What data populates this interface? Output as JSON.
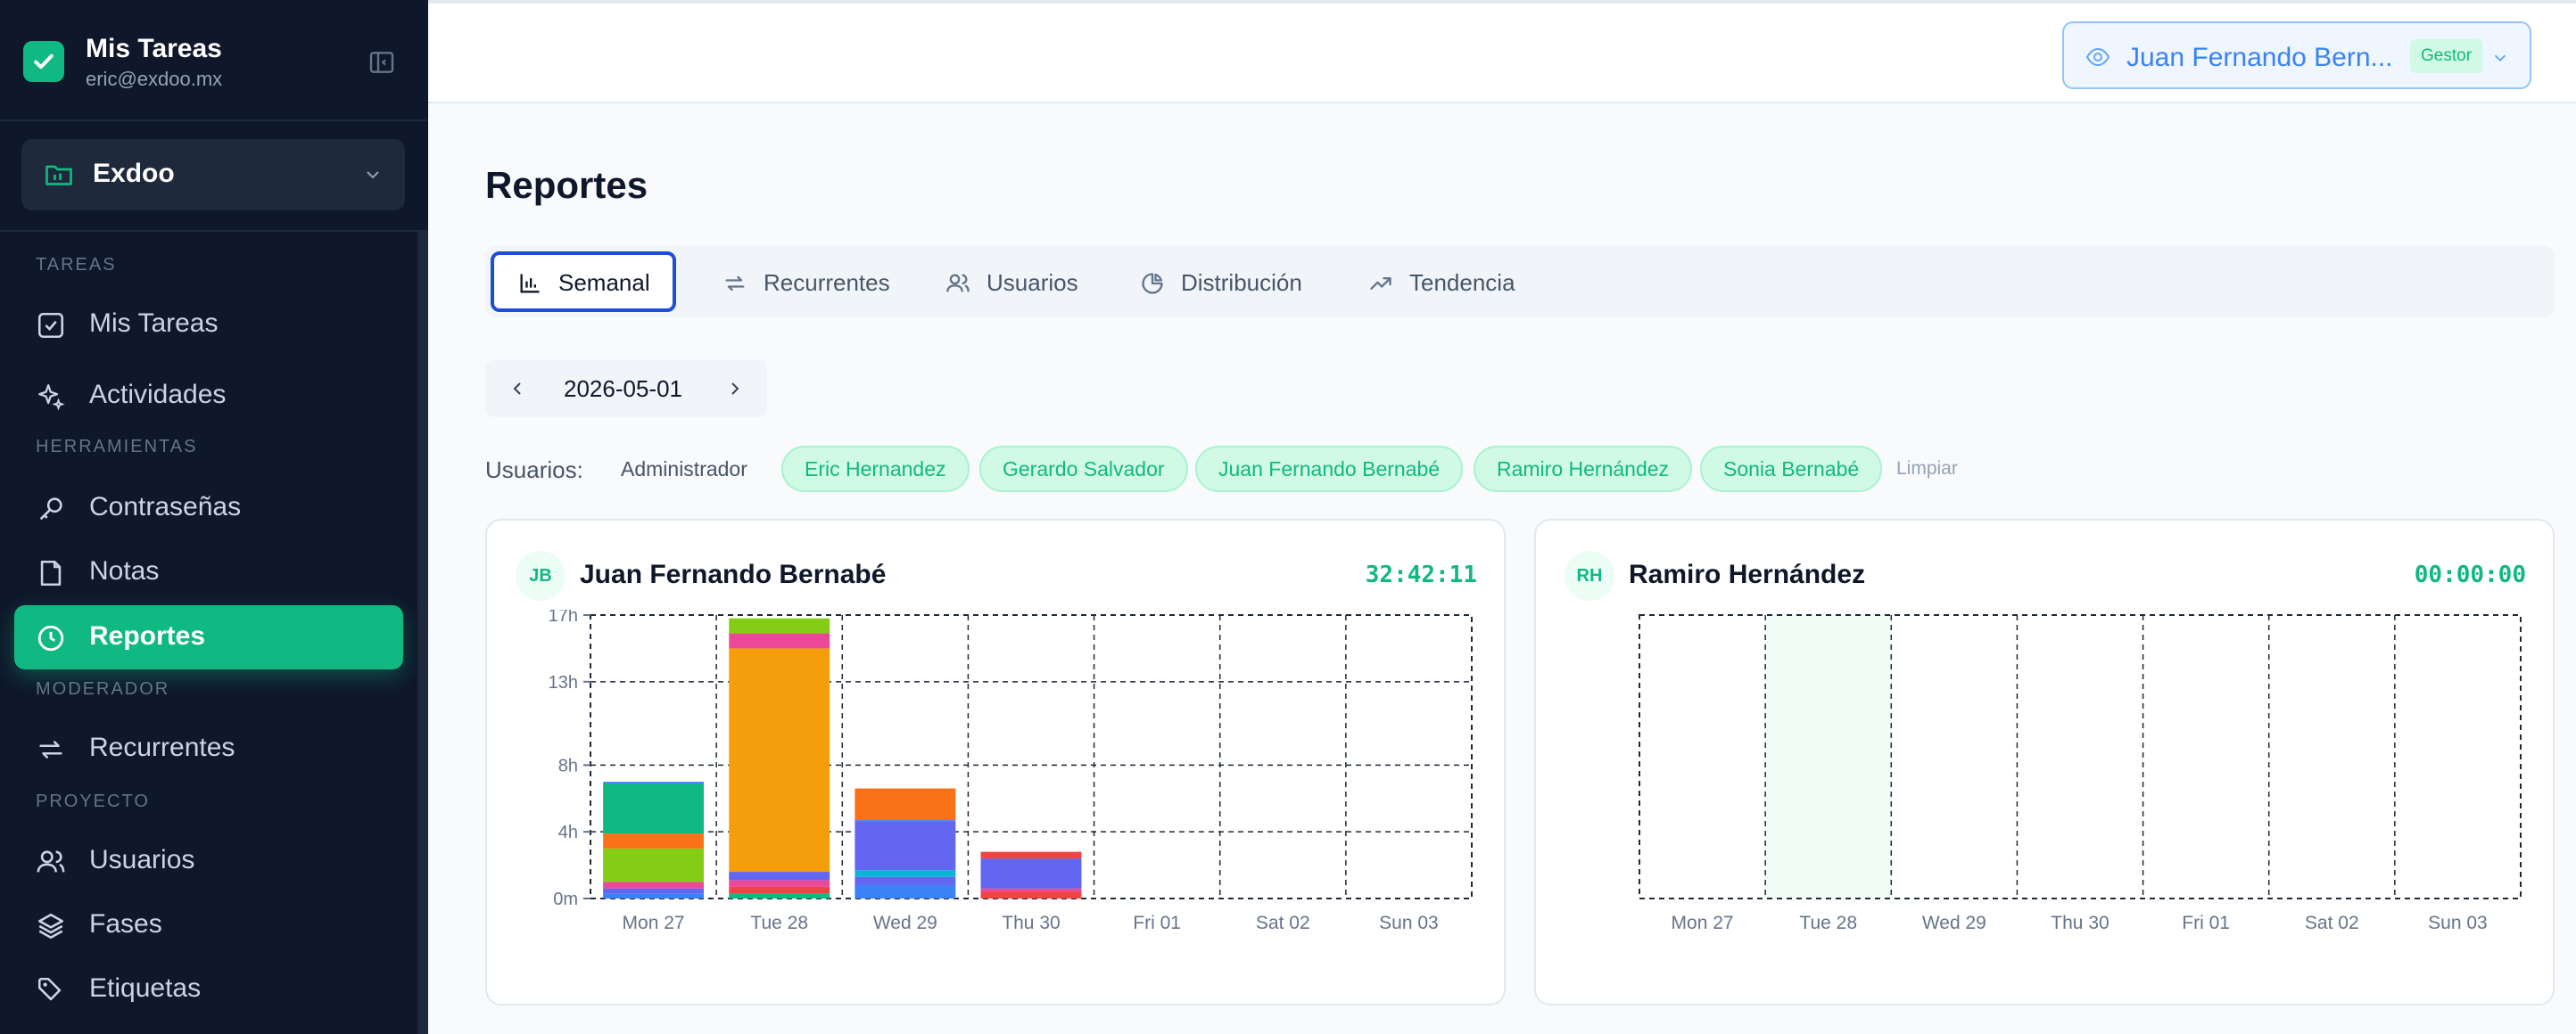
{
  "sidebar": {
    "brand": {
      "title": "Mis Tareas",
      "email": "eric@exdoo.mx"
    },
    "workspace": {
      "name": "Exdoo"
    },
    "sections": {
      "tareas": "TAREAS",
      "herramientas": "HERRAMIENTAS",
      "moderador": "MODERADOR",
      "proyecto": "PROYECTO"
    },
    "items": [
      {
        "label": "Mis Tareas",
        "icon": "checkbox-icon"
      },
      {
        "label": "Actividades",
        "icon": "sparkles-icon"
      },
      {
        "label": "Contraseñas",
        "icon": "key-icon"
      },
      {
        "label": "Notas",
        "icon": "note-icon"
      },
      {
        "label": "Reportes",
        "icon": "clock-icon",
        "active": true
      },
      {
        "label": "Recurrentes",
        "icon": "repeat-icon"
      },
      {
        "label": "Usuarios",
        "icon": "users-icon"
      },
      {
        "label": "Fases",
        "icon": "layers-icon"
      },
      {
        "label": "Etiquetas",
        "icon": "tags-icon"
      }
    ]
  },
  "topbar": {
    "view_as": {
      "name": "Juan Fernando Bern...",
      "role": "Gestor",
      "icon": "eye-icon"
    }
  },
  "main": {
    "title": "Reportes",
    "tabs": [
      {
        "label": "Semanal",
        "icon": "bar-chart-icon",
        "active": true
      },
      {
        "label": "Recurrentes",
        "icon": "repeat-icon"
      },
      {
        "label": "Usuarios",
        "icon": "users-icon"
      },
      {
        "label": "Distribución",
        "icon": "pie-chart-icon"
      },
      {
        "label": "Tendencia",
        "icon": "trending-up-icon"
      }
    ],
    "date": "2026-05-01",
    "users_filter": {
      "label": "Usuarios:",
      "users": [
        {
          "name": "Administrador",
          "selected": false
        },
        {
          "name": "Eric Hernandez",
          "selected": true
        },
        {
          "name": "Gerardo Salvador",
          "selected": true
        },
        {
          "name": "Juan Fernando Bernabé",
          "selected": true
        },
        {
          "name": "Ramiro Hernández",
          "selected": true
        },
        {
          "name": "Sonia Bernabé",
          "selected": true
        }
      ],
      "clear": "Limpiar"
    }
  },
  "colors": {
    "accent": "#10b981",
    "sidebar_bg": "#0f172a",
    "tab_active_border": "#1d4ed8",
    "chart_palette": [
      "#3b82f6",
      "#6366f1",
      "#ec4899",
      "#84cc16",
      "#f97316",
      "#10b981",
      "#f59e0b",
      "#ef4444",
      "#06b6d4"
    ]
  },
  "chart_data": [
    {
      "type": "bar",
      "stacked": true,
      "user": "Juan Fernando Bernabé",
      "avatar": "JB",
      "total": "32:42:11",
      "categories": [
        "Mon 27",
        "Tue 28",
        "Wed 29",
        "Thu 30",
        "Fri 01",
        "Sat 02",
        "Sun 03"
      ],
      "y_ticks": [
        "0m",
        "4h",
        "8h",
        "13h",
        "17h"
      ],
      "ylim": [
        0,
        17
      ],
      "grid": true,
      "stacks": [
        [
          {
            "value": 0.3,
            "color": "#3b82f6"
          },
          {
            "value": 0.3,
            "color": "#6366f1"
          },
          {
            "value": 0.4,
            "color": "#ec4899"
          },
          {
            "value": 2.0,
            "color": "#84cc16"
          },
          {
            "value": 0.9,
            "color": "#f97316"
          },
          {
            "value": 3.0,
            "color": "#10b981"
          },
          {
            "value": 0.1,
            "color": "#3b82f6"
          }
        ],
        [
          {
            "value": 0.3,
            "color": "#10b981"
          },
          {
            "value": 0.4,
            "color": "#ef4444"
          },
          {
            "value": 0.4,
            "color": "#ec4899"
          },
          {
            "value": 0.5,
            "color": "#6366f1"
          },
          {
            "value": 13.4,
            "color": "#f59e0b"
          },
          {
            "value": 0.1,
            "color": "#ec4899"
          },
          {
            "value": 0.8,
            "color": "#ec4899"
          },
          {
            "value": 0.9,
            "color": "#84cc16"
          }
        ],
        [
          {
            "value": 0.8,
            "color": "#3b82f6"
          },
          {
            "value": 0.5,
            "color": "#6366f1"
          },
          {
            "value": 0.4,
            "color": "#06b6d4"
          },
          {
            "value": 2.9,
            "color": "#6366f1"
          },
          {
            "value": 0.1,
            "color": "#3b82f6"
          },
          {
            "value": 1.9,
            "color": "#f97316"
          }
        ],
        [
          {
            "value": 0.4,
            "color": "#ef4444"
          },
          {
            "value": 0.2,
            "color": "#ec4899"
          },
          {
            "value": 1.8,
            "color": "#6366f1"
          },
          {
            "value": 0.4,
            "color": "#ef4444"
          }
        ],
        [],
        [],
        []
      ]
    },
    {
      "type": "bar",
      "stacked": true,
      "user": "Ramiro Hernández",
      "avatar": "RH",
      "total": "00:00:00",
      "categories": [
        "Mon 27",
        "Tue 28",
        "Wed 29",
        "Thu 30",
        "Fri 01",
        "Sat 02",
        "Sun 03"
      ],
      "highlighted_category": "Tue 28",
      "y_ticks": [],
      "grid": true,
      "stacks": [
        [],
        [],
        [],
        [],
        [],
        [],
        []
      ]
    }
  ]
}
